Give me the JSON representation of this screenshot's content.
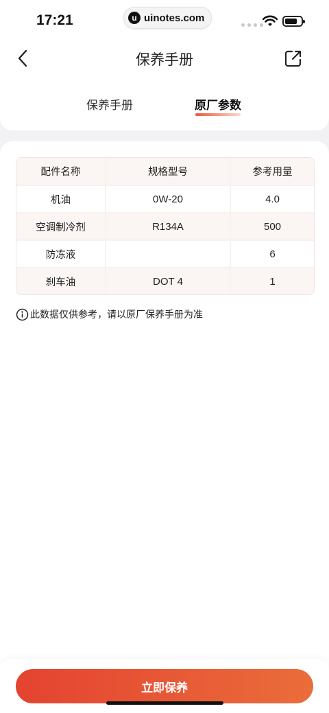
{
  "status": {
    "time": "17:21",
    "watermark": "uinotes.com",
    "watermark_logo": "u"
  },
  "header": {
    "title": "保养手册",
    "back_icon": "chevron-left-icon",
    "share_icon": "share-icon"
  },
  "tabs": [
    {
      "label": "保养手册",
      "active": false
    },
    {
      "label": "原厂参数",
      "active": true
    }
  ],
  "table": {
    "headers": [
      "配件名称",
      "规格型号",
      "参考用量"
    ],
    "rows": [
      [
        "机油",
        "0W-20",
        "4.0"
      ],
      [
        "空调制冷剂",
        "R134A",
        "500"
      ],
      [
        "防冻液",
        "",
        "6"
      ],
      [
        "刹车油",
        "DOT 4",
        "1"
      ]
    ]
  },
  "note": "此数据仅供参考，请以原厂保养手册为准",
  "cta": {
    "label": "立即保养"
  },
  "colors": {
    "accent": "#e44330",
    "accent_end": "#ea6d3b",
    "table_header_bg": "#fbf5f3"
  }
}
